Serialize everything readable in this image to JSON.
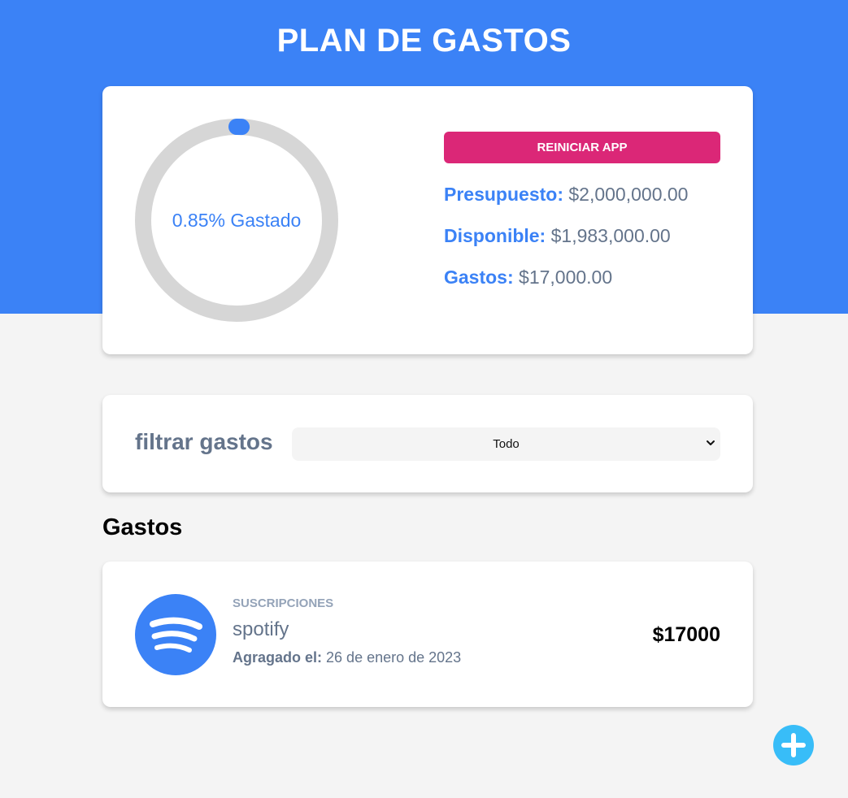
{
  "header": {
    "title": "PLAN DE GASTOS",
    "background_color": "#3b82f6"
  },
  "budget": {
    "progress_text": "0.85% Gastado",
    "progress_fraction": 0.0085,
    "reset_label": "REINICIAR APP",
    "budget_label": "Presupuesto:",
    "budget_value": "$2,000,000.00",
    "available_label": "Disponible:",
    "available_value": "$1,983,000.00",
    "spent_label": "Gastos:",
    "spent_value": "$17,000.00",
    "accent_color": "#3b82f6",
    "reset_color": "#db2777",
    "ring_track_color": "#d6d6d6"
  },
  "filter": {
    "label": "filtrar gastos",
    "selected_option": "Todo"
  },
  "expenses": {
    "title": "Gastos",
    "items": [
      {
        "category": "SUSCRIPCIONES",
        "name": "spotify",
        "date_label": "Agragado el:",
        "date_value": "26 de enero de 2023",
        "amount": "$17000",
        "icon": "spotify-icon"
      }
    ]
  },
  "add_button": {
    "icon": "plus-icon",
    "color": "#38bdf8"
  }
}
